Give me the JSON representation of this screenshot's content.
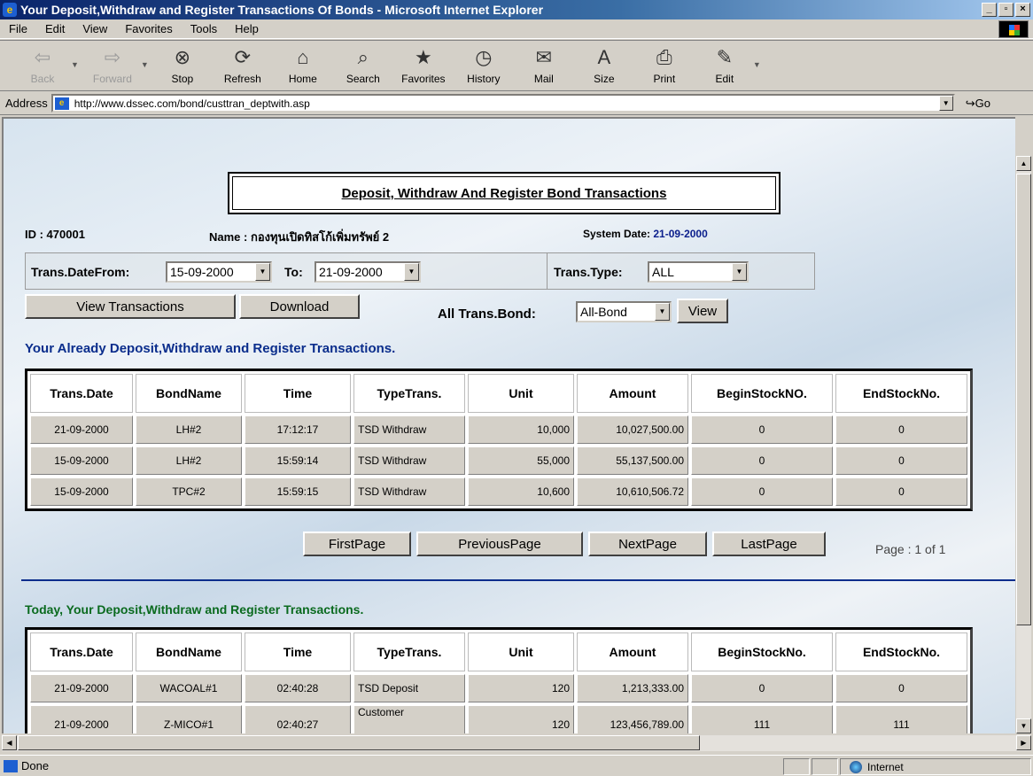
{
  "window": {
    "title": "Your Deposit,Withdraw and Register Transactions Of Bonds - Microsoft Internet Explorer"
  },
  "menu": [
    "File",
    "Edit",
    "View",
    "Favorites",
    "Tools",
    "Help"
  ],
  "toolbar": [
    {
      "label": "Back",
      "icon": "back-arrow-icon",
      "disabled": true
    },
    {
      "label": "Forward",
      "icon": "forward-arrow-icon",
      "disabled": true
    },
    {
      "label": "Stop",
      "icon": "stop-icon"
    },
    {
      "label": "Refresh",
      "icon": "refresh-icon"
    },
    {
      "label": "Home",
      "icon": "home-icon"
    },
    {
      "label": "Search",
      "icon": "search-icon"
    },
    {
      "label": "Favorites",
      "icon": "favorites-icon"
    },
    {
      "label": "History",
      "icon": "history-icon"
    },
    {
      "label": "Mail",
      "icon": "mail-icon"
    },
    {
      "label": "Size",
      "icon": "size-icon"
    },
    {
      "label": "Print",
      "icon": "print-icon"
    },
    {
      "label": "Edit",
      "icon": "edit-icon"
    }
  ],
  "address": {
    "label": "Address",
    "url": "http://www.dssec.com/bond/custtran_deptwith.asp",
    "go": "Go"
  },
  "page": {
    "title": "Deposit, Withdraw And Register Bond Transactions",
    "id_text": "ID : 470001",
    "name_text": "Name : กองทุนเปิดทิสโก้เพิ่มทรัพย์ 2",
    "system_date_label": "System Date: ",
    "system_date": "21-09-2000",
    "filters": {
      "date_from_label": "Trans.DateFrom:",
      "date_from": "15-09-2000",
      "to_label": "To:",
      "date_to": "21-09-2000",
      "type_label": "Trans.Type:",
      "type_value": "ALL",
      "bond_label": "All Trans.Bond:",
      "bond_value": "All-Bond"
    },
    "buttons": {
      "view_transactions": "View Transactions",
      "download": "Download",
      "view": "View",
      "first": "FirstPage",
      "previous": "PreviousPage",
      "next": "NextPage",
      "last": "LastPage"
    },
    "already_heading": "Your Already Deposit,Withdraw and Register Transactions.",
    "already_columns": [
      "Trans.Date",
      "BondName",
      "Time",
      "TypeTrans.",
      "Unit",
      "Amount",
      "BeginStockNO.",
      "EndStockNo."
    ],
    "already_rows": [
      [
        "21-09-2000",
        "LH#2",
        "17:12:17",
        "TSD Withdraw",
        "10,000",
        "10,027,500.00",
        "0",
        "0"
      ],
      [
        "15-09-2000",
        "LH#2",
        "15:59:14",
        "TSD Withdraw",
        "55,000",
        "55,137,500.00",
        "0",
        "0"
      ],
      [
        "15-09-2000",
        "TPC#2",
        "15:59:15",
        "TSD Withdraw",
        "10,600",
        "10,610,506.72",
        "0",
        "0"
      ]
    ],
    "page_info": "Page : 1 of 1",
    "today_heading": "Today, Your Deposit,Withdraw and Register Transactions.",
    "today_columns": [
      "Trans.Date",
      "BondName",
      "Time",
      "TypeTrans.",
      "Unit",
      "Amount",
      "BeginStockNo.",
      "EndStockNo."
    ],
    "today_rows": [
      [
        "21-09-2000",
        "WACOAL#1",
        "02:40:28",
        "TSD Deposit",
        "120",
        "1,213,333.00",
        "0",
        "0"
      ],
      [
        "21-09-2000",
        "Z-MICO#1",
        "02:40:27",
        "Customer",
        "120",
        "123,456,789.00",
        "111",
        "111"
      ]
    ]
  },
  "status": {
    "text": "Done",
    "zone": "Internet"
  }
}
